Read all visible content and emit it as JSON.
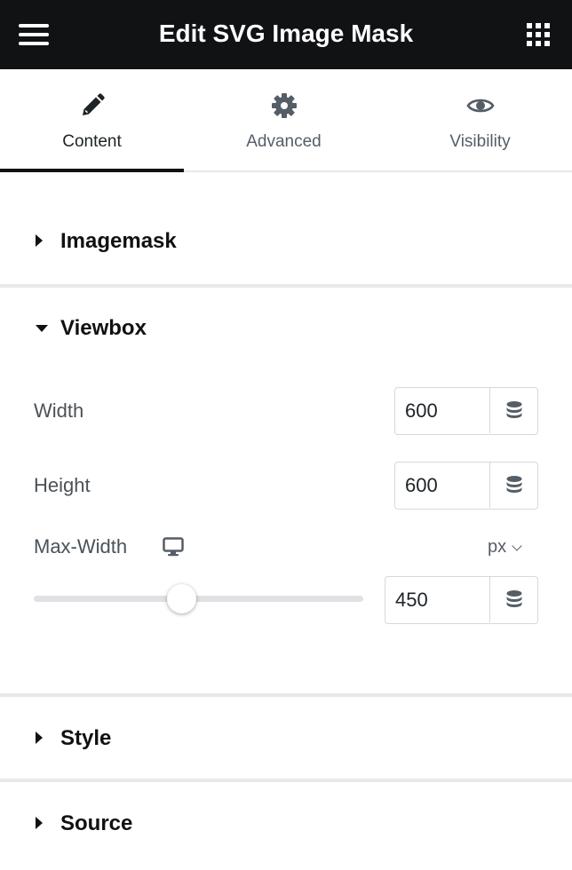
{
  "header": {
    "title": "Edit SVG Image Mask",
    "menu_icon": "hamburger-menu-icon",
    "apps_icon": "apps-grid-icon",
    "background": "#111214"
  },
  "tabs": [
    {
      "label": "Content",
      "icon": "pencil-icon",
      "active": true
    },
    {
      "label": "Advanced",
      "icon": "gear-icon",
      "active": false
    },
    {
      "label": "Visibility",
      "icon": "eye-icon",
      "active": false
    }
  ],
  "sections": {
    "imagemask": {
      "title": "Imagemask",
      "expanded": false
    },
    "viewbox": {
      "title": "Viewbox",
      "expanded": true,
      "width": {
        "label": "Width",
        "value": "600"
      },
      "height": {
        "label": "Height",
        "value": "600"
      },
      "max_width": {
        "label": "Max-Width",
        "device_icon": "desktop-icon",
        "unit": "px",
        "value": "450",
        "slider_fraction": 0.45
      }
    },
    "style": {
      "title": "Style",
      "expanded": false
    },
    "source": {
      "title": "Source",
      "expanded": false
    }
  }
}
